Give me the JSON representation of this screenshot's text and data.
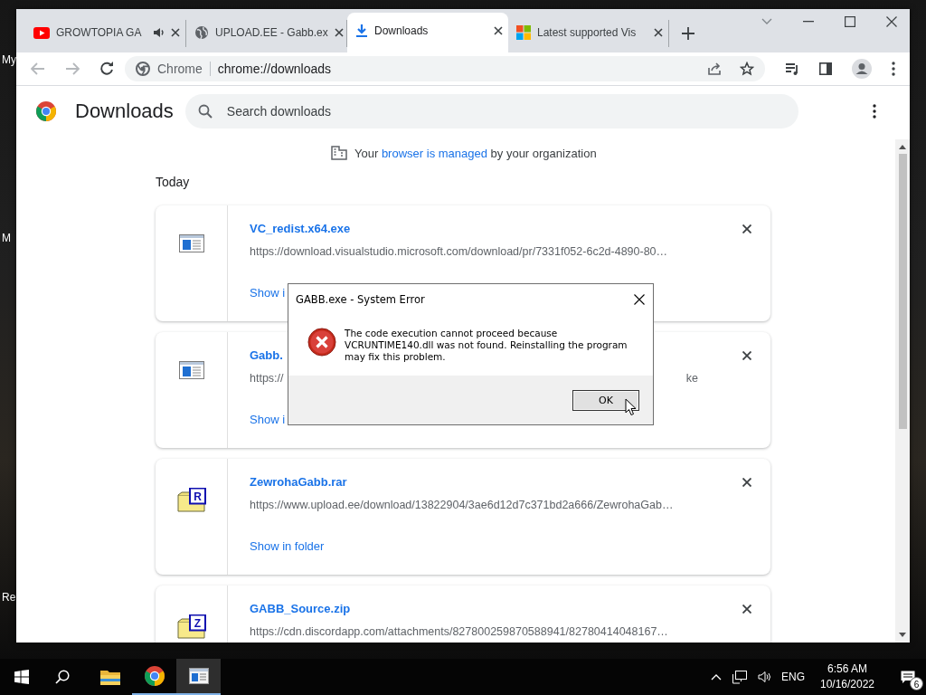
{
  "desktop": {
    "icon_labels": [
      {
        "text": "My"
      },
      {
        "text": "M"
      },
      {
        "text": "Re"
      }
    ]
  },
  "browser": {
    "tabs": [
      {
        "title": "GROWTOPIA GA",
        "kind": "video",
        "audio": true,
        "selected": false
      },
      {
        "title": "UPLOAD.EE - Gabb.ex",
        "kind": "globe",
        "audio": false,
        "selected": false
      },
      {
        "title": "Downloads",
        "kind": "download",
        "audio": false,
        "selected": true
      },
      {
        "title": "Latest supported Vis",
        "kind": "windows",
        "audio": false,
        "selected": false
      }
    ],
    "omnibox": {
      "chip": "Chrome",
      "url": "chrome://downloads"
    }
  },
  "page": {
    "title": "Downloads",
    "search": {
      "placeholder": "Search downloads"
    },
    "notice": {
      "before": "Your ",
      "link": "browser is managed",
      "after": " by your organization"
    },
    "section": "Today",
    "downloads": [
      {
        "name": "VC_redist.x64.exe",
        "url": "https://download.visualstudio.microsoft.com/download/pr/7331f052-6c2d-4890-80…",
        "action": "Show i",
        "kind": "exe"
      },
      {
        "name": "Gabb.",
        "url": "https://",
        "url_end": "ke",
        "action": "Show i",
        "kind": "exe"
      },
      {
        "name": "ZewrohaGabb.rar",
        "url": "https://www.upload.ee/download/13822904/3ae6d12d7c371bd2a666/ZewrohaGab…",
        "action": "Show in folder",
        "kind": "archive",
        "badge": "R"
      },
      {
        "name": "GABB_Source.zip",
        "url": "https://cdn.discordapp.com/attachments/827800259870588941/82780414048167…",
        "kind": "archive",
        "badge": "Z"
      }
    ]
  },
  "dialog": {
    "title": "GABB.exe - System Error",
    "message": "The code execution cannot proceed because VCRUNTIME140.dll was not found. Reinstalling the program may fix this problem.",
    "button": "OK"
  },
  "taskbar": {
    "apps": [
      {
        "kind": "folder",
        "running": false,
        "selected": false
      },
      {
        "kind": "chrome",
        "running": true,
        "selected": false
      },
      {
        "kind": "window",
        "running": true,
        "selected": true
      }
    ],
    "language": "ENG",
    "time": "6:56 AM",
    "date": "10/16/2022",
    "notifications": "6"
  }
}
